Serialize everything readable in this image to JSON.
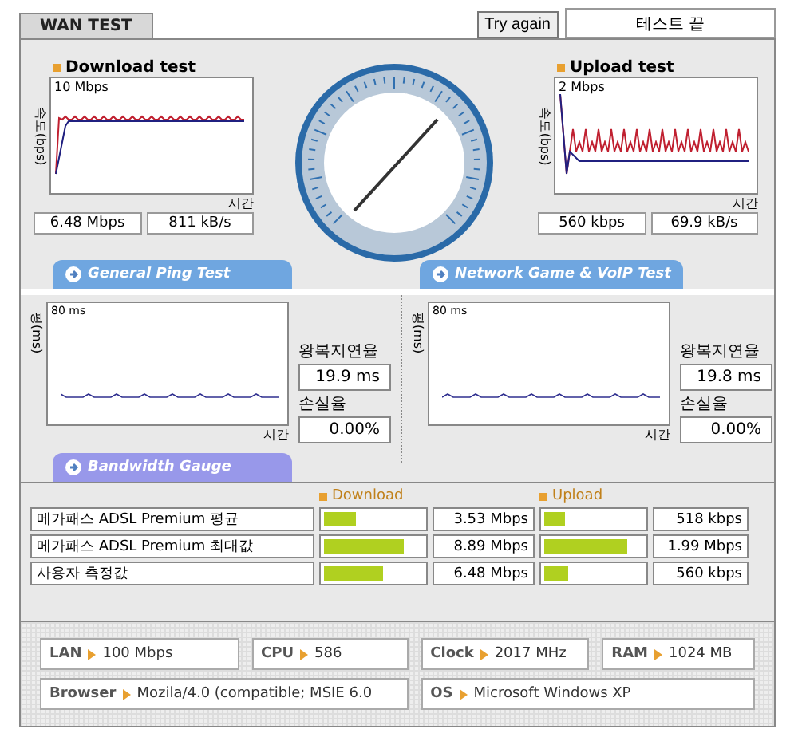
{
  "tabs": [
    {
      "label": "WAN TEST",
      "selected": true
    }
  ],
  "try_again": "Try again",
  "status": "테스트 끝",
  "speed_tests": [
    {
      "kind": "download",
      "title": "Download test",
      "ylabel": "속도(bps)",
      "scale": "10 Mbps",
      "xlabel": "시간",
      "readings": [
        "6.48 Mbps",
        "811 kB/s"
      ]
    },
    {
      "kind": "upload",
      "title": "Upload test",
      "ylabel": "속도(bps)",
      "scale": "2 Mbps",
      "xlabel": "시간",
      "readings": [
        "560 kbps",
        "69.9 kB/s"
      ]
    }
  ],
  "ping_tests": [
    {
      "heading": "General Ping Test",
      "ylabel": "핑(ms)",
      "scale": "80 ms",
      "xlabel": "시간",
      "latency_label": "왕복지연율",
      "latency": "19.9 ms",
      "loss_label": "손실율",
      "loss": "0.00%"
    },
    {
      "heading": "Network Game & VoIP Test",
      "ylabel": "핑(ms)",
      "scale": "80 ms",
      "xlabel": "시간",
      "latency_label": "왕복지연율",
      "latency": "19.8 ms",
      "loss_label": "손실율",
      "loss": "0.00%"
    }
  ],
  "bandwidth": {
    "heading": "Bandwidth Gauge",
    "columns": [
      "Download",
      "Upload"
    ],
    "rows": [
      {
        "name": "메가패스 ADSL Premium 평균",
        "download": {
          "level": 0.32,
          "reading": "3.53 Mbps"
        },
        "upload": {
          "level": 0.21,
          "reading": "518 kbps"
        }
      },
      {
        "name": "메가패스 ADSL Premium 최대값",
        "download": {
          "level": 0.81,
          "reading": "8.89 Mbps"
        },
        "upload": {
          "level": 0.84,
          "reading": "1.99 Mbps"
        }
      },
      {
        "name": "사용자 측정값",
        "download": {
          "level": 0.6,
          "reading": "6.48 Mbps"
        },
        "upload": {
          "level": 0.24,
          "reading": "560 kbps"
        }
      }
    ]
  },
  "system": [
    {
      "label": "LAN",
      "value": "100 Mbps"
    },
    {
      "label": "CPU",
      "value": "586"
    },
    {
      "label": "Clock",
      "value": "2017 MHz"
    },
    {
      "label": "RAM",
      "value": "1024 MB"
    },
    {
      "label": "Browser",
      "value": "Mozila/4.0 (compatible; MSIE 6.0"
    },
    {
      "label": "OS",
      "value": "Microsoft Windows XP"
    }
  ]
}
